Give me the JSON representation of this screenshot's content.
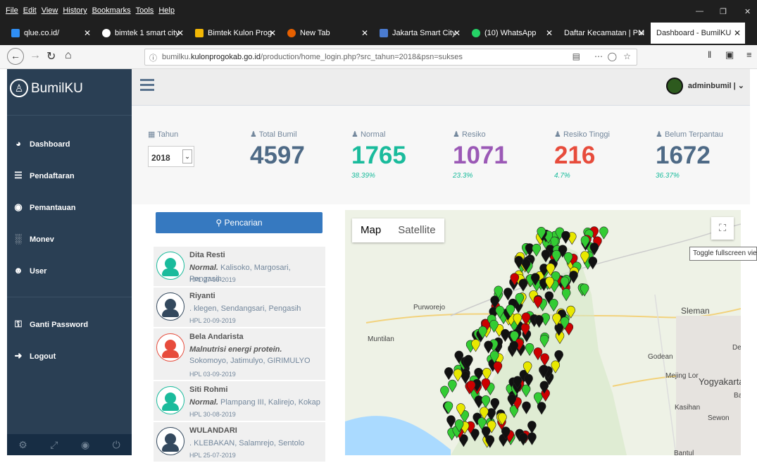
{
  "menubar": {
    "items": [
      "File",
      "Edit",
      "View",
      "History",
      "Bookmarks",
      "Tools",
      "Help"
    ]
  },
  "tabs": [
    {
      "label": "qlue.co.id/",
      "color": "#2f8ef4"
    },
    {
      "label": "bimtek 1 smart city",
      "color": "#ffffff"
    },
    {
      "label": "Bimtek Kulon Prog",
      "color": "#f2b705"
    },
    {
      "label": "New Tab",
      "color": "#e66000"
    },
    {
      "label": "Jakarta Smart City",
      "color": "#4a7bd0"
    },
    {
      "label": "(10) WhatsApp",
      "color": "#25d366"
    },
    {
      "label": "Daftar Kecamatan | PM",
      "color": "#444444"
    },
    {
      "label": "Dashboard - BumilKU",
      "color": "#ffffff"
    }
  ],
  "url": {
    "pre": "bumilku.",
    "host": "kulonprogokab.go.id",
    "path": "/production/home_login.php?src_tahun=2018&psn=sukses"
  },
  "sidebar": {
    "brand": "BumilKU",
    "items": [
      {
        "label": "Dashboard",
        "icon": "dashboard-icon"
      },
      {
        "label": "Pendaftaran",
        "icon": "list-icon"
      },
      {
        "label": "Pemantauan",
        "icon": "eye-icon"
      },
      {
        "label": "Monev",
        "icon": "bar-chart-icon"
      },
      {
        "label": "User",
        "icon": "users-icon"
      },
      {
        "label": "Ganti Password",
        "icon": "key-icon"
      },
      {
        "label": "Logout",
        "icon": "sign-out-icon"
      }
    ]
  },
  "topnav": {
    "user": "adminbumil |"
  },
  "stats": {
    "year_label": "Tahun",
    "year": "2018",
    "cards": [
      {
        "label": "Total Bumil",
        "value": "4597",
        "pct": "",
        "color": "#73879c"
      },
      {
        "label": "Normal",
        "value": "1765",
        "pct": "38.39%",
        "color": "#1abb9c"
      },
      {
        "label": "Resiko",
        "value": "1071",
        "pct": "23.3%",
        "color": "#9b59b6"
      },
      {
        "label": "Resiko Tinggi",
        "value": "216",
        "pct": "4.7%",
        "color": "#e74c3c"
      },
      {
        "label": "Belum Terpantau",
        "value": "1672",
        "pct": "36.37%",
        "color": "#73879c"
      }
    ]
  },
  "list": {
    "search_label": "Pencarian",
    "items": [
      {
        "name": "Dita Resti",
        "status": "Normal.",
        "addr": "Kalisoko, Margosari, Pengasih",
        "hpl": "HPL 27-09-2019",
        "color": "#1abb9c"
      },
      {
        "name": "Riyanti",
        "status": "",
        "addr": ". klegen, Sendangsari, Pengasih",
        "hpl": "HPL 20-09-2019",
        "color": "#34495e"
      },
      {
        "name": "Bela Andarista",
        "status": "Malnutrisi energi protein.",
        "addr": "Sokomoyo, Jatimulyo, GIRIMULYO",
        "hpl": "HPL 03-09-2019",
        "color": "#e74c3c"
      },
      {
        "name": "Siti Rohmi",
        "status": "Normal.",
        "addr": "Plampang III, Kalirejo, Kokap",
        "hpl": "HPL 30-08-2019",
        "color": "#1abb9c"
      },
      {
        "name": "WULANDARI",
        "status": "",
        "addr": ". KLEBAKAN, Salamrejo, Sentolo",
        "hpl": "HPL 25-07-2019",
        "color": "#34495e"
      }
    ]
  },
  "map": {
    "type_map": "Map",
    "type_satellite": "Satellite",
    "tooltip": "Toggle fullscreen view",
    "labels": [
      "Purworejo",
      "Muntilan",
      "Sleman",
      "Godean",
      "Mejing Lor",
      "Yogyakarta",
      "Kasihan",
      "Sewon",
      "Bantul",
      "Dep",
      "Ba"
    ],
    "pin_colors": {
      "normal": "#33cc33",
      "risk": "#e8e800",
      "high_risk": "#cc0000",
      "unmonitored": "#111111"
    }
  }
}
